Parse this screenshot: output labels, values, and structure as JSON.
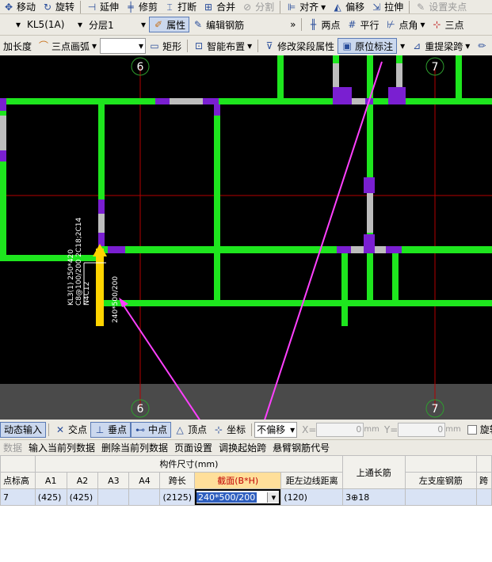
{
  "toolbar1": {
    "move": "移动",
    "rotate": "旋转",
    "extend": "延伸",
    "trim": "修剪",
    "break": "打断",
    "merge": "合并",
    "split": "分割",
    "align": "对齐",
    "offset": "偏移",
    "stretch": "拉伸",
    "set_point": "设置夹点"
  },
  "toolbar2": {
    "component": "KL5(1A)",
    "floor": "分层1",
    "properties": "属性",
    "edit_rebar": "编辑钢筋",
    "overflow": "»",
    "two_points": "两点",
    "parallel": "平行",
    "point_angle": "点角",
    "three_points": "三点"
  },
  "toolbar3": {
    "add_length": "加长度",
    "arc": "三点画弧",
    "arc_combo": "",
    "rect": "矩形",
    "smart": "智能布置",
    "modify_beam": "修改梁段属性",
    "orig_mark": "原位标注",
    "reextract": "重提梁跨"
  },
  "canvas": {
    "axis_6_top": "6",
    "axis_7_top": "7",
    "axis_6_bottom": "6",
    "axis_7_bottom": "7",
    "beam_label_1": "KL3(1) 250*420",
    "beam_label_2": "C8@100/200 2C18;2C14",
    "beam_label_3": "N4C12",
    "beam_label_4": "240*500/200"
  },
  "snapbar": {
    "dynamic_input": "动态输入",
    "intersection": "交点",
    "perpendicular": "垂点",
    "midpoint": "中点",
    "vertex": "顶点",
    "coordinate": "坐标",
    "no_offset": "不偏移",
    "x_label": "X=",
    "x_value": "0",
    "y_label": "Y=",
    "y_value": "0",
    "unit": "mm",
    "rotate": "旋转"
  },
  "gridbar": {
    "data": "数据",
    "input_current": "输入当前列数据",
    "delete_current": "删除当前列数据",
    "page_setup": "页面设置",
    "adjust_span": "调换起始跨",
    "cantilever": "悬臂钢筋代号"
  },
  "grid": {
    "group_header": "构件尺寸(mm)",
    "headers": [
      "点标高",
      "A1",
      "A2",
      "A3",
      "A4",
      "跨长",
      "截面(B*H)",
      "距左边线距离",
      "上通长筋",
      "左支座钢筋",
      "跨"
    ],
    "row": [
      "7",
      "(425)",
      "(425)",
      "",
      "",
      "(2125)",
      "240*500/200",
      "(120)",
      "3⊕18",
      "",
      ""
    ]
  },
  "colors": {
    "beam": "#1ee61e",
    "support": "#7a1fd1",
    "rebar": "#bdbdbd",
    "axis": "#b40000",
    "axis_circle": "#2e9e2e",
    "arrow": "#ff40ff",
    "marker": "#ffd400"
  }
}
